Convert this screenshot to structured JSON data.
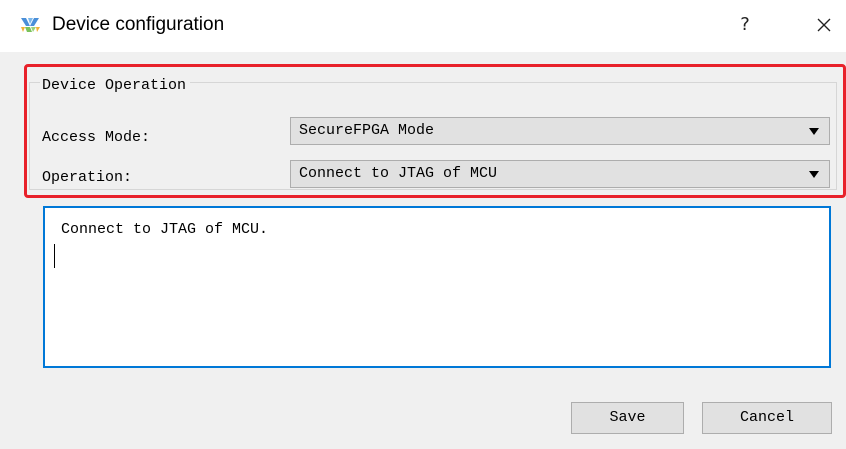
{
  "window": {
    "title": "Device configuration",
    "help_label": "?",
    "icon": "app-logo-icon"
  },
  "group": {
    "title": "Device Operation",
    "access_mode": {
      "label": "Access Mode:",
      "value": "SecureFPGA Mode"
    },
    "operation": {
      "label": "Operation:",
      "value": "Connect to JTAG of MCU"
    }
  },
  "description": {
    "text": "Connect to JTAG of MCU."
  },
  "buttons": {
    "save_label": "Save",
    "cancel_label": "Cancel"
  },
  "colors": {
    "highlight": "#e8212a",
    "focus_border": "#0078d7",
    "dialog_bg": "#f0f0f0"
  }
}
